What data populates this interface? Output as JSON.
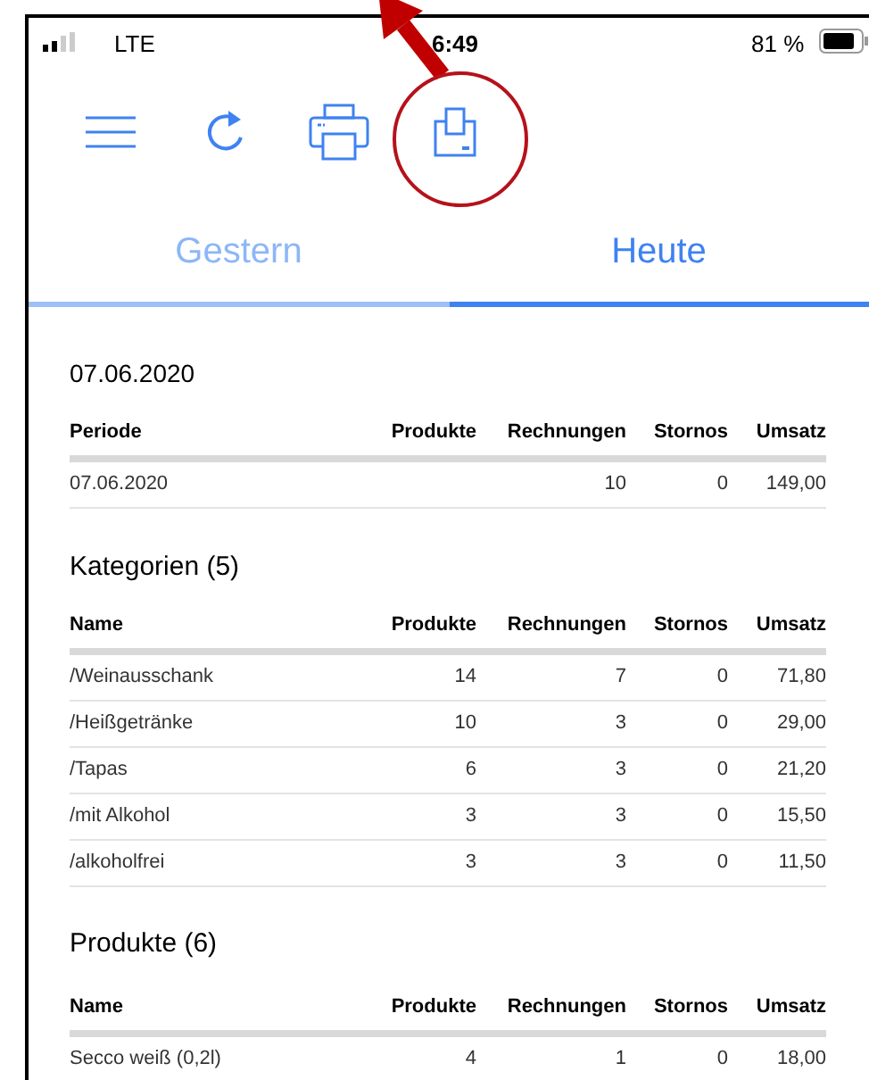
{
  "status_bar": {
    "carrier": "LTE",
    "time": "6:49",
    "battery": "81 %"
  },
  "toolbar": [
    {
      "kind": "menu"
    },
    {
      "kind": "refresh"
    },
    {
      "kind": "print"
    },
    {
      "kind": "save"
    }
  ],
  "tabs": [
    {
      "label": "Gestern",
      "selected": false
    },
    {
      "label": "Heute",
      "selected": true
    }
  ],
  "sections": [
    {
      "title": "07.06.2020",
      "columns": [
        "Periode",
        "Produkte",
        "Rechnungen",
        "Stornos",
        "Umsatz"
      ],
      "rows": [
        [
          "07.06.2020",
          "",
          "10",
          "0",
          "149,00"
        ]
      ]
    },
    {
      "title": "Kategorien (5)",
      "columns": [
        "Name",
        "Produkte",
        "Rechnungen",
        "Stornos",
        "Umsatz"
      ],
      "rows": [
        [
          "/Weinausschank",
          "14",
          "7",
          "0",
          "71,80"
        ],
        [
          "/Heißgetränke",
          "10",
          "3",
          "0",
          "29,00"
        ],
        [
          "/Tapas",
          "6",
          "3",
          "0",
          "21,20"
        ],
        [
          "/mit Alkohol",
          "3",
          "3",
          "0",
          "15,50"
        ],
        [
          "/alkoholfrei",
          "3",
          "3",
          "0",
          "11,50"
        ]
      ]
    },
    {
      "title": "Produkte (6)",
      "columns": [
        "Name",
        "Produkte",
        "Rechnungen",
        "Stornos",
        "Umsatz"
      ],
      "rows": [
        [
          "Secco weiß (0,2l)",
          "4",
          "1",
          "0",
          "18,00"
        ]
      ]
    }
  ],
  "annotations": [
    {
      "kind": "arrow"
    },
    {
      "kind": "circle"
    }
  ]
}
